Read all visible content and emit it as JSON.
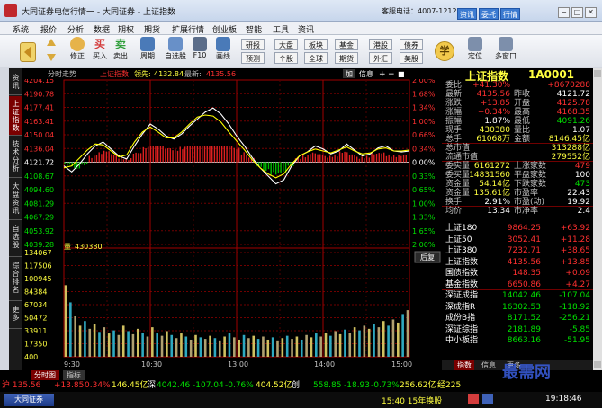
{
  "window": {
    "title": "大同证券电信行情一 - 大同证券 - 上证指数",
    "hotline": "客服电话：4007-121212",
    "buttons": [
      "资讯",
      "委托",
      "行情"
    ],
    "controls": [
      "−",
      "□",
      "✕"
    ]
  },
  "menu": [
    "系统",
    "报价",
    "分析",
    "数据",
    "期权",
    "期货",
    "扩展行情",
    "创业板",
    "智能",
    "工具",
    "资讯"
  ],
  "toolbar": {
    "big": [
      {
        "label": "修正",
        "icon": "refresh-icon",
        "color": "#d8a640"
      },
      {
        "label": "买入",
        "icon": "buy-icon",
        "color": "#d43d3d",
        "glyph": "买"
      },
      {
        "label": "卖出",
        "icon": "sell-icon",
        "color": "#2e9e3a",
        "glyph": "卖"
      },
      {
        "label": "周期",
        "icon": "period-icon",
        "color": "#4a7ab8"
      },
      {
        "label": "自选股",
        "icon": "watchlist-icon",
        "color": "#4a7ab8"
      },
      {
        "label": "F10",
        "icon": "f10-icon",
        "color": "#5b6d8a"
      },
      {
        "label": "画线",
        "icon": "draw-line-icon",
        "color": "#4a7ab8"
      }
    ],
    "small": [
      "研报",
      "预测",
      "大盘",
      "个股",
      "板块",
      "全球",
      "基金",
      "期货",
      "港股",
      "外汇",
      "债券",
      "美股"
    ],
    "right": [
      "定位",
      "多窗口"
    ]
  },
  "lefttabs": [
    "资讯",
    "上证指数",
    "技术分析",
    "大盘资讯",
    "自选股",
    "综合排名",
    "更多"
  ],
  "chart": {
    "header": "分时走势",
    "name": "上证指数",
    "lead_label": "领先:",
    "lead_val": "4132.84",
    "latest_label": "最新:",
    "latest_val": "4135.56",
    "header_right": [
      "加",
      "信息",
      "+",
      "−",
      "■"
    ],
    "price_ticks": [
      "4204.15",
      "4190.78",
      "4177.41",
      "4163.41",
      "4150.04",
      "4136.04",
      "4121.72",
      "4108.67",
      "4094.60",
      "4081.29",
      "4067.29",
      "4053.92",
      "4039.28"
    ],
    "pct_ticks": [
      "2.00%",
      "1.68%",
      "1.34%",
      "1.00%",
      "0.66%",
      "0.34%",
      "0.00%",
      "0.33%",
      "0.65%",
      "1.00%",
      "1.33%",
      "1.65%",
      "2.00%"
    ],
    "vol_label": "量",
    "vol_value": "430380",
    "vol_ticks": [
      "134067",
      "117506",
      "100945",
      "84384",
      "67034",
      "50472",
      "33911",
      "17350",
      "400"
    ],
    "time_ticks": [
      "9:30",
      "10:30",
      "13:00",
      "14:00",
      "15:00"
    ],
    "back_label": "后复"
  },
  "chart_data": {
    "type": "line",
    "title": "分时走势 上证指数",
    "xlabel": "",
    "ylabel": "",
    "x_ticks": [
      "9:30",
      "10:30",
      "13:00",
      "14:00",
      "15:00"
    ],
    "ylim": [
      4039.28,
      4204.15
    ],
    "prev_close": 4121.72,
    "series": [
      {
        "name": "上证指数",
        "color": "#ffffff",
        "values": [
          4118,
          4112,
          4120,
          4130,
          4138,
          4142,
          4135,
          4128,
          4125,
          4138,
          4150,
          4160,
          4155,
          4148,
          4145,
          4150,
          4158,
          4165,
          4172,
          4176,
          4170,
          4160,
          4148,
          4138,
          4126,
          4116,
          4108,
          4100,
          4104,
          4118,
          4128,
          4132,
          4138,
          4135,
          4130,
          4133,
          4140,
          4134,
          4128,
          4130,
          4136,
          4138,
          4133,
          4132,
          4133
        ]
      },
      {
        "name": "领先",
        "color": "#ffff00",
        "values": [
          4116,
          4118,
          4126,
          4134,
          4140,
          4139,
          4133,
          4127,
          4129,
          4142,
          4152,
          4157,
          4152,
          4146,
          4146,
          4152,
          4160,
          4167,
          4169,
          4168,
          4162,
          4152,
          4143,
          4134,
          4124,
          4116,
          4110,
          4106,
          4110,
          4120,
          4128,
          4132,
          4135,
          4133,
          4131,
          4134,
          4137,
          4133,
          4130,
          4131,
          4135,
          4136,
          4133,
          4133,
          4134
        ]
      }
    ],
    "volume": {
      "max": 134067,
      "bars": [
        92000,
        70000,
        52000,
        40000,
        46000,
        36000,
        42000,
        32000,
        38000,
        30000,
        34000,
        28000,
        40000,
        33000,
        29000,
        36000,
        31000,
        26000,
        38000,
        30000,
        27000,
        33000,
        28000,
        24000,
        30000,
        26000,
        22000,
        28000,
        25000,
        23000,
        27000,
        24000,
        21000,
        26000,
        30000,
        25000,
        22000,
        28000,
        24000,
        27000,
        23000,
        26000,
        22000,
        25000,
        21000,
        24000,
        27000,
        23000,
        26000,
        22000,
        28000,
        25000,
        30000,
        26000,
        31000,
        27000,
        33000,
        29000,
        35000,
        31000,
        38000,
        34000,
        40000,
        36000,
        42000,
        38000,
        46000,
        40000,
        48000,
        44000,
        55000,
        60000
      ]
    }
  },
  "quote": {
    "title": "上证指数",
    "code": "1A0001",
    "rows": [
      {
        "l": "委比",
        "v": "+41.30%",
        "vc": "red",
        "l2": "",
        "v2": "+8670288",
        "v2c": "red"
      },
      {
        "l": "最新",
        "v": "4135.56",
        "vc": "red",
        "l2": "昨收",
        "v2": "4121.72",
        "v2c": "wht"
      },
      {
        "l": "涨跌",
        "v": "+13.85",
        "vc": "red",
        "l2": "开盘",
        "v2": "4125.78",
        "v2c": "red"
      },
      {
        "l": "涨幅",
        "v": "+0.34%",
        "vc": "red",
        "l2": "最高",
        "v2": "4168.35",
        "v2c": "red"
      },
      {
        "l": "振幅",
        "v": "1.87%",
        "vc": "wht",
        "l2": "最低",
        "v2": "4091.26",
        "v2c": "grn"
      },
      {
        "l": "现手",
        "v": "430380",
        "vc": "yel",
        "l2": "量比",
        "v2": "1.07",
        "v2c": "wht"
      },
      {
        "l": "总手",
        "v": "61068万",
        "vc": "yel",
        "l2": "金额",
        "v2": "8146.45亿",
        "v2c": "yel"
      },
      {
        "l": "总市值",
        "v": "",
        "vc": "wht",
        "l2": "",
        "v2": "313288亿",
        "v2c": "yel"
      },
      {
        "l": "流通市值",
        "v": "",
        "vc": "wht",
        "l2": "",
        "v2": "279552亿",
        "v2c": "yel"
      },
      {
        "l": "委实量",
        "v": "6161272",
        "vc": "yel",
        "l2": "上涨家数",
        "v2": "479",
        "v2c": "red"
      },
      {
        "l": "委买量",
        "v": "14831560",
        "vc": "yel",
        "l2": "平盘家数",
        "v2": "100",
        "v2c": "wht"
      },
      {
        "l": "资金量",
        "v": "54.14亿",
        "vc": "yel",
        "l2": "下跌家数",
        "v2": "473",
        "v2c": "grn"
      },
      {
        "l": "资金量",
        "v": "135.61亿",
        "vc": "yel",
        "l2": "市盈率",
        "v2": "22.43",
        "v2c": "wht"
      },
      {
        "l": "换手",
        "v": "2.91%",
        "vc": "wht",
        "l2": "市盈(动)",
        "v2": "19.92",
        "v2c": "wht"
      },
      {
        "l": "均价",
        "v": "13.34",
        "vc": "wht",
        "l2": "市净率",
        "v2": "2.4",
        "v2c": "wht"
      }
    ],
    "indices": [
      {
        "n": "上证180",
        "p": "9864.25",
        "c": "+63.92",
        "cls": "red"
      },
      {
        "n": "上证50",
        "p": "3052.41",
        "c": "+11.28",
        "cls": "red"
      },
      {
        "n": "上证380",
        "p": "7232.71",
        "c": "+38.65",
        "cls": "red"
      },
      {
        "n": "上证指数",
        "p": "4135.56",
        "c": "+13.85",
        "cls": "red"
      },
      {
        "n": "国债指数",
        "p": "148.35",
        "c": "+0.09",
        "cls": "red"
      },
      {
        "n": "基金指数",
        "p": "6650.86",
        "c": "+4.27",
        "cls": "red"
      },
      {
        "n": "深证成指",
        "p": "14042.46",
        "c": "-107.04",
        "cls": "grn"
      },
      {
        "n": "深成指R",
        "p": "16302.53",
        "c": "-118.92",
        "cls": "grn"
      },
      {
        "n": "成份B指",
        "p": "8171.52",
        "c": "-256.21",
        "cls": "grn"
      },
      {
        "n": "深证综指",
        "p": "2181.89",
        "c": "-5.85",
        "cls": "grn"
      },
      {
        "n": "中小板指",
        "p": "8663.16",
        "c": "-51.95",
        "cls": "grn"
      }
    ],
    "tabs": [
      "指数",
      "信息",
      "更多"
    ]
  },
  "tabbar": [
    "分时图",
    "指标"
  ],
  "status": {
    "sh": "沪 135.56",
    "sh_chg": "+13.85",
    "sh_pct": "0.34%",
    "sh_amt": "146.45亿",
    "sz_label": "深",
    "sz": "4042.46",
    "sz_chg": "-107.04",
    "sz_pct": "-0.76%",
    "sz_amt": "404.52亿",
    "cy_label": "创",
    "cy": "558.85",
    "cy_chg": "-18.93",
    "cy_pct": "-0.73%",
    "cy_amt": "256.62亿",
    "jing": "经225"
  },
  "status2": {
    "brand": "大同证券",
    "date": "15:40 15年换股",
    "clock": "19:18:46"
  },
  "watermark": "最需网"
}
